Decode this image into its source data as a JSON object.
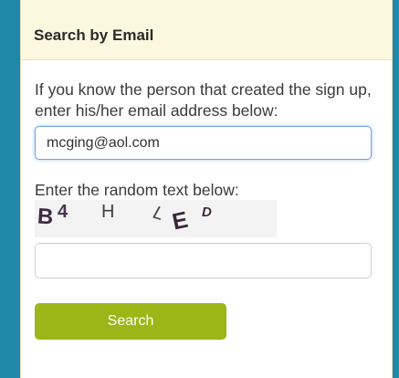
{
  "panel": {
    "title": "Search by Email"
  },
  "form": {
    "intro": "If you know the person that created the sign up, enter his/her email address below:",
    "email_value": "mcging@aol.com",
    "captcha_label": "Enter the random text below:",
    "captcha_chars": [
      "B",
      "4",
      "H",
      "L",
      "E",
      "D"
    ],
    "captcha_value": "",
    "search_label": "Search"
  },
  "colors": {
    "page_background": "#1f87a8",
    "header_background": "#fcf8df",
    "button_background": "#9cb617",
    "input_focus_border": "#6fa4e6"
  }
}
